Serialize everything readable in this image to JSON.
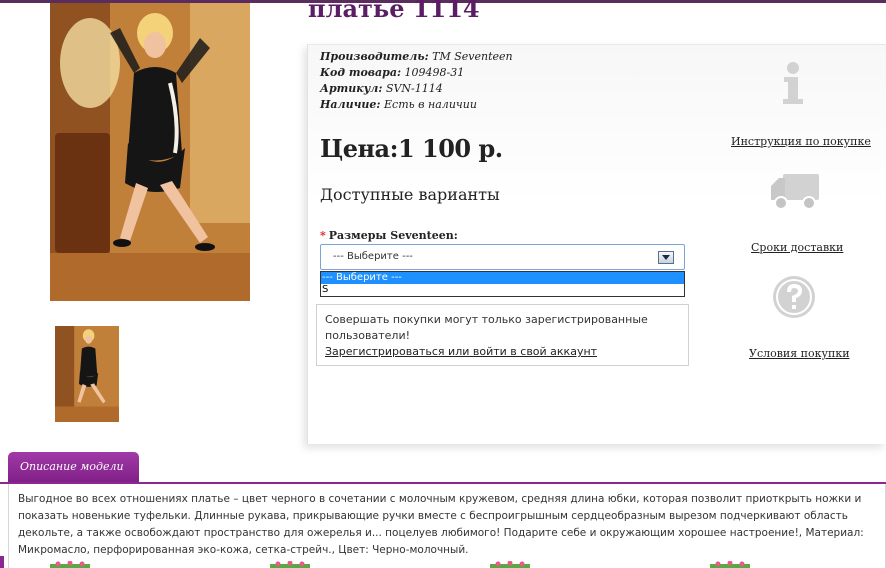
{
  "product": {
    "title": "платье 1114"
  },
  "specs": [
    {
      "label": "Производитель:",
      "value": "TM Seventeen"
    },
    {
      "label": "Код товара:",
      "value": "109498-31"
    },
    {
      "label": "Артикул:",
      "value": "SVN-1114"
    },
    {
      "label": "Наличие:",
      "value": "Есть в наличии"
    }
  ],
  "price": "Цена:1 100 р.",
  "options": {
    "title": "Доступные варианты",
    "required_mark": "*",
    "size_label": "Размеры Seventeen:",
    "selected_value": "--- Выберите ---",
    "dropdown_options": [
      "--- Выберите ---",
      "S"
    ]
  },
  "login_notice": {
    "text": "Совершать покупки могут только зарегистрированные пользователи!",
    "link": "Зарегистрироваться или войти в свой аккаунт"
  },
  "side_info": {
    "instructions_link": "Инструкция по покупке",
    "delivery_link": "Сроки доставки",
    "terms_link": "Условия покупки"
  },
  "description": {
    "tab_label": "Описание модели",
    "text": "Выгодное во всех отношениях платье – цвет черного в сочетании с молочным кружевом, средняя длина юбки, которая позволит приоткрыть ножки и показать новенькие туфельки. Длинные рукава, прикрывающие ручки вместе с беспроигрышным сердцеобразным вырезом подчеркивают область декольте, а также освобождают пространство для ожерелья и... поцелуев любимого! Подарите себе и окружающим хорошее настроение!, Материал: Микромасло, перфорированная эко-кожа, сетка-стрейч., Цвет: Черно-молочный."
  },
  "colors": {
    "brand_purple": "#5b1d63",
    "tab_purple": "#8a2790",
    "select_highlight": "#1e90ff",
    "required_red": "#e02020"
  },
  "icons": [
    "info-icon",
    "truck-icon",
    "question-icon",
    "dropdown-arrow-icon"
  ]
}
